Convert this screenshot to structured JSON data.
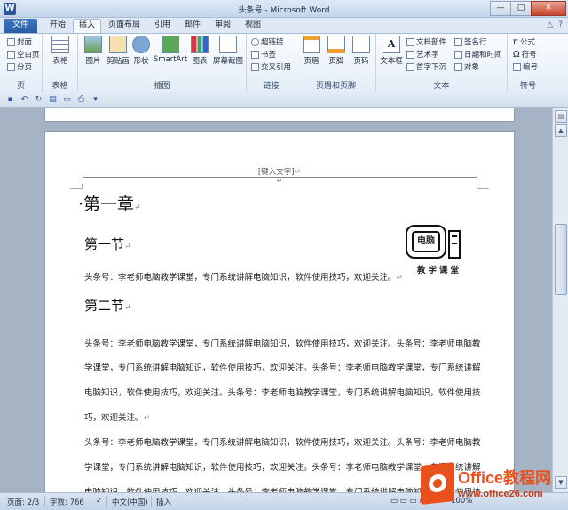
{
  "window": {
    "app_icon": "W",
    "title": "头条号 - Microsoft Word",
    "minimize": "—",
    "maximize": "□",
    "close": "✕"
  },
  "tabs": [
    {
      "label": "文件"
    },
    {
      "label": "开始"
    },
    {
      "label": "插入"
    },
    {
      "label": "页面布局"
    },
    {
      "label": "引用"
    },
    {
      "label": "邮件"
    },
    {
      "label": "审阅"
    },
    {
      "label": "视图"
    }
  ],
  "active_tab": "插入",
  "help_icons": [
    "△",
    "?"
  ],
  "ribbon": {
    "pages": {
      "items": [
        "封面",
        "空白页",
        "分页"
      ],
      "label": "页"
    },
    "tables": {
      "button": "表格",
      "label": "表格"
    },
    "illustrations": {
      "buttons": [
        "图片",
        "剪贴画",
        "形状",
        "SmartArt",
        "图表",
        "屏幕截图"
      ],
      "label": "插图"
    },
    "links": {
      "items": [
        "超链接",
        "书签",
        "交叉引用"
      ],
      "label": "链接"
    },
    "header_footer": {
      "buttons": [
        "页眉",
        "页脚",
        "页码"
      ],
      "label": "页眉和页脚"
    },
    "text": {
      "textbox": "文本框",
      "items": [
        "文档部件",
        "艺术字",
        "首字下沉",
        "签名行",
        "日期和时间",
        "对象"
      ],
      "label": "文本"
    },
    "symbols": {
      "items": [
        "公式",
        "符号",
        "编号"
      ],
      "label": "符号"
    }
  },
  "document": {
    "header_placeholder": "[键入文字]",
    "chapter": "第一章",
    "section1": "第一节",
    "section2": "第二节",
    "pilcrow": "↵",
    "line1": "头条号：李老师电脑教学课堂，专门系统讲解电脑知识，软件使用技巧，欢迎关注。",
    "para2": [
      "头条号：李老师电脑教学课堂，专门系统讲解电脑知识，软件使用技巧，欢迎关注。头条号：李老师电脑教",
      "学课堂，专门系统讲解电脑知识，软件使用技巧，欢迎关注。头条号：李老师电脑教学课堂，专门系统讲解",
      "电脑知识，软件使用技巧，欢迎关注。头条号：李老师电脑教学课堂，专门系统讲解电脑知识，软件使用技",
      "巧，欢迎关注。"
    ],
    "para3": [
      "头条号：李老师电脑教学课堂，专门系统讲解电脑知识，软件使用技巧，欢迎关注。头条号：李老师电脑教",
      "学课堂，专门系统讲解电脑知识，软件使用技巧，欢迎关注。头条号：李老师电脑教学课堂，专门系统讲解",
      "电脑知识，软件使用技巧，欢迎关注。头条号：李老师电脑教学课堂，专门系统讲解电脑知识，软件使用技"
    ],
    "logo": {
      "screen_text": "电脑",
      "caption": "教学课堂"
    }
  },
  "statusbar": {
    "page": "页面: 2/3",
    "words": "字数: 766",
    "language": "中文(中国)",
    "mode": "插入",
    "zoom": "100%"
  },
  "watermark": {
    "name": "Office教程网",
    "url": "www.office26.com"
  },
  "colors": {
    "file_tab": "#2a5ea5",
    "ribbon_bg": "#e4edf7",
    "doc_bg": "#a6b3c4",
    "watermark": "#e8501c"
  }
}
